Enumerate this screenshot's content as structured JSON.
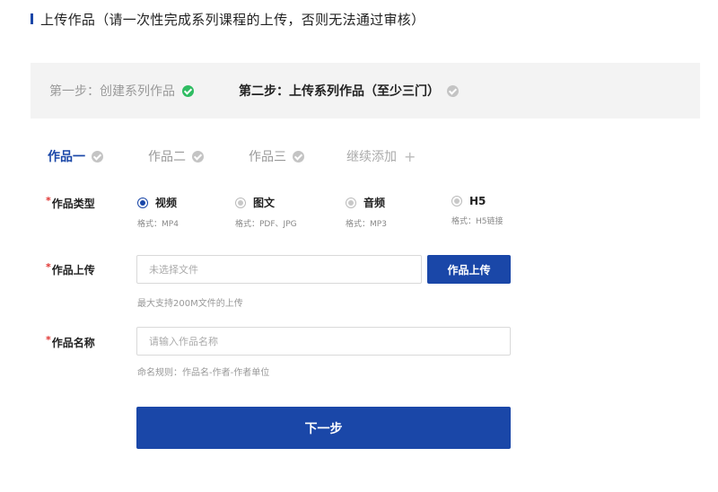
{
  "header": {
    "title": "上传作品（请一次性完成系列课程的上传，否则无法通过审核）"
  },
  "steps": [
    {
      "label": "第一步：创建系列作品"
    },
    {
      "label": "第二步：上传系列作品（至少三门）"
    }
  ],
  "tabs": [
    {
      "label": "作品一"
    },
    {
      "label": "作品二"
    },
    {
      "label": "作品三"
    },
    {
      "label": "继续添加",
      "icon": "plus-icon"
    }
  ],
  "form": {
    "required_mark": "*",
    "type": {
      "label": "作品类型",
      "options": [
        {
          "label": "视频",
          "format": "格式：MP4",
          "selected": true
        },
        {
          "label": "图文",
          "format": "格式：PDF、JPG",
          "selected": false
        },
        {
          "label": "音频",
          "format": "格式：MP3",
          "selected": false
        },
        {
          "label": "H5",
          "format": "格式：H5链接",
          "selected": false
        }
      ]
    },
    "upload": {
      "label": "作品上传",
      "placeholder": "未选择文件",
      "button": "作品上传",
      "hint": "最大支持200M文件的上传"
    },
    "name": {
      "label": "作品名称",
      "placeholder": "请输入作品名称",
      "hint": "命名规则：作品名-作者-作者单位"
    }
  },
  "actions": {
    "next": "下一步"
  },
  "colors": {
    "accent": "#1a47a8",
    "success": "#2fbc62",
    "required": "#e0322f",
    "step_bg": "#f3f3f3"
  }
}
